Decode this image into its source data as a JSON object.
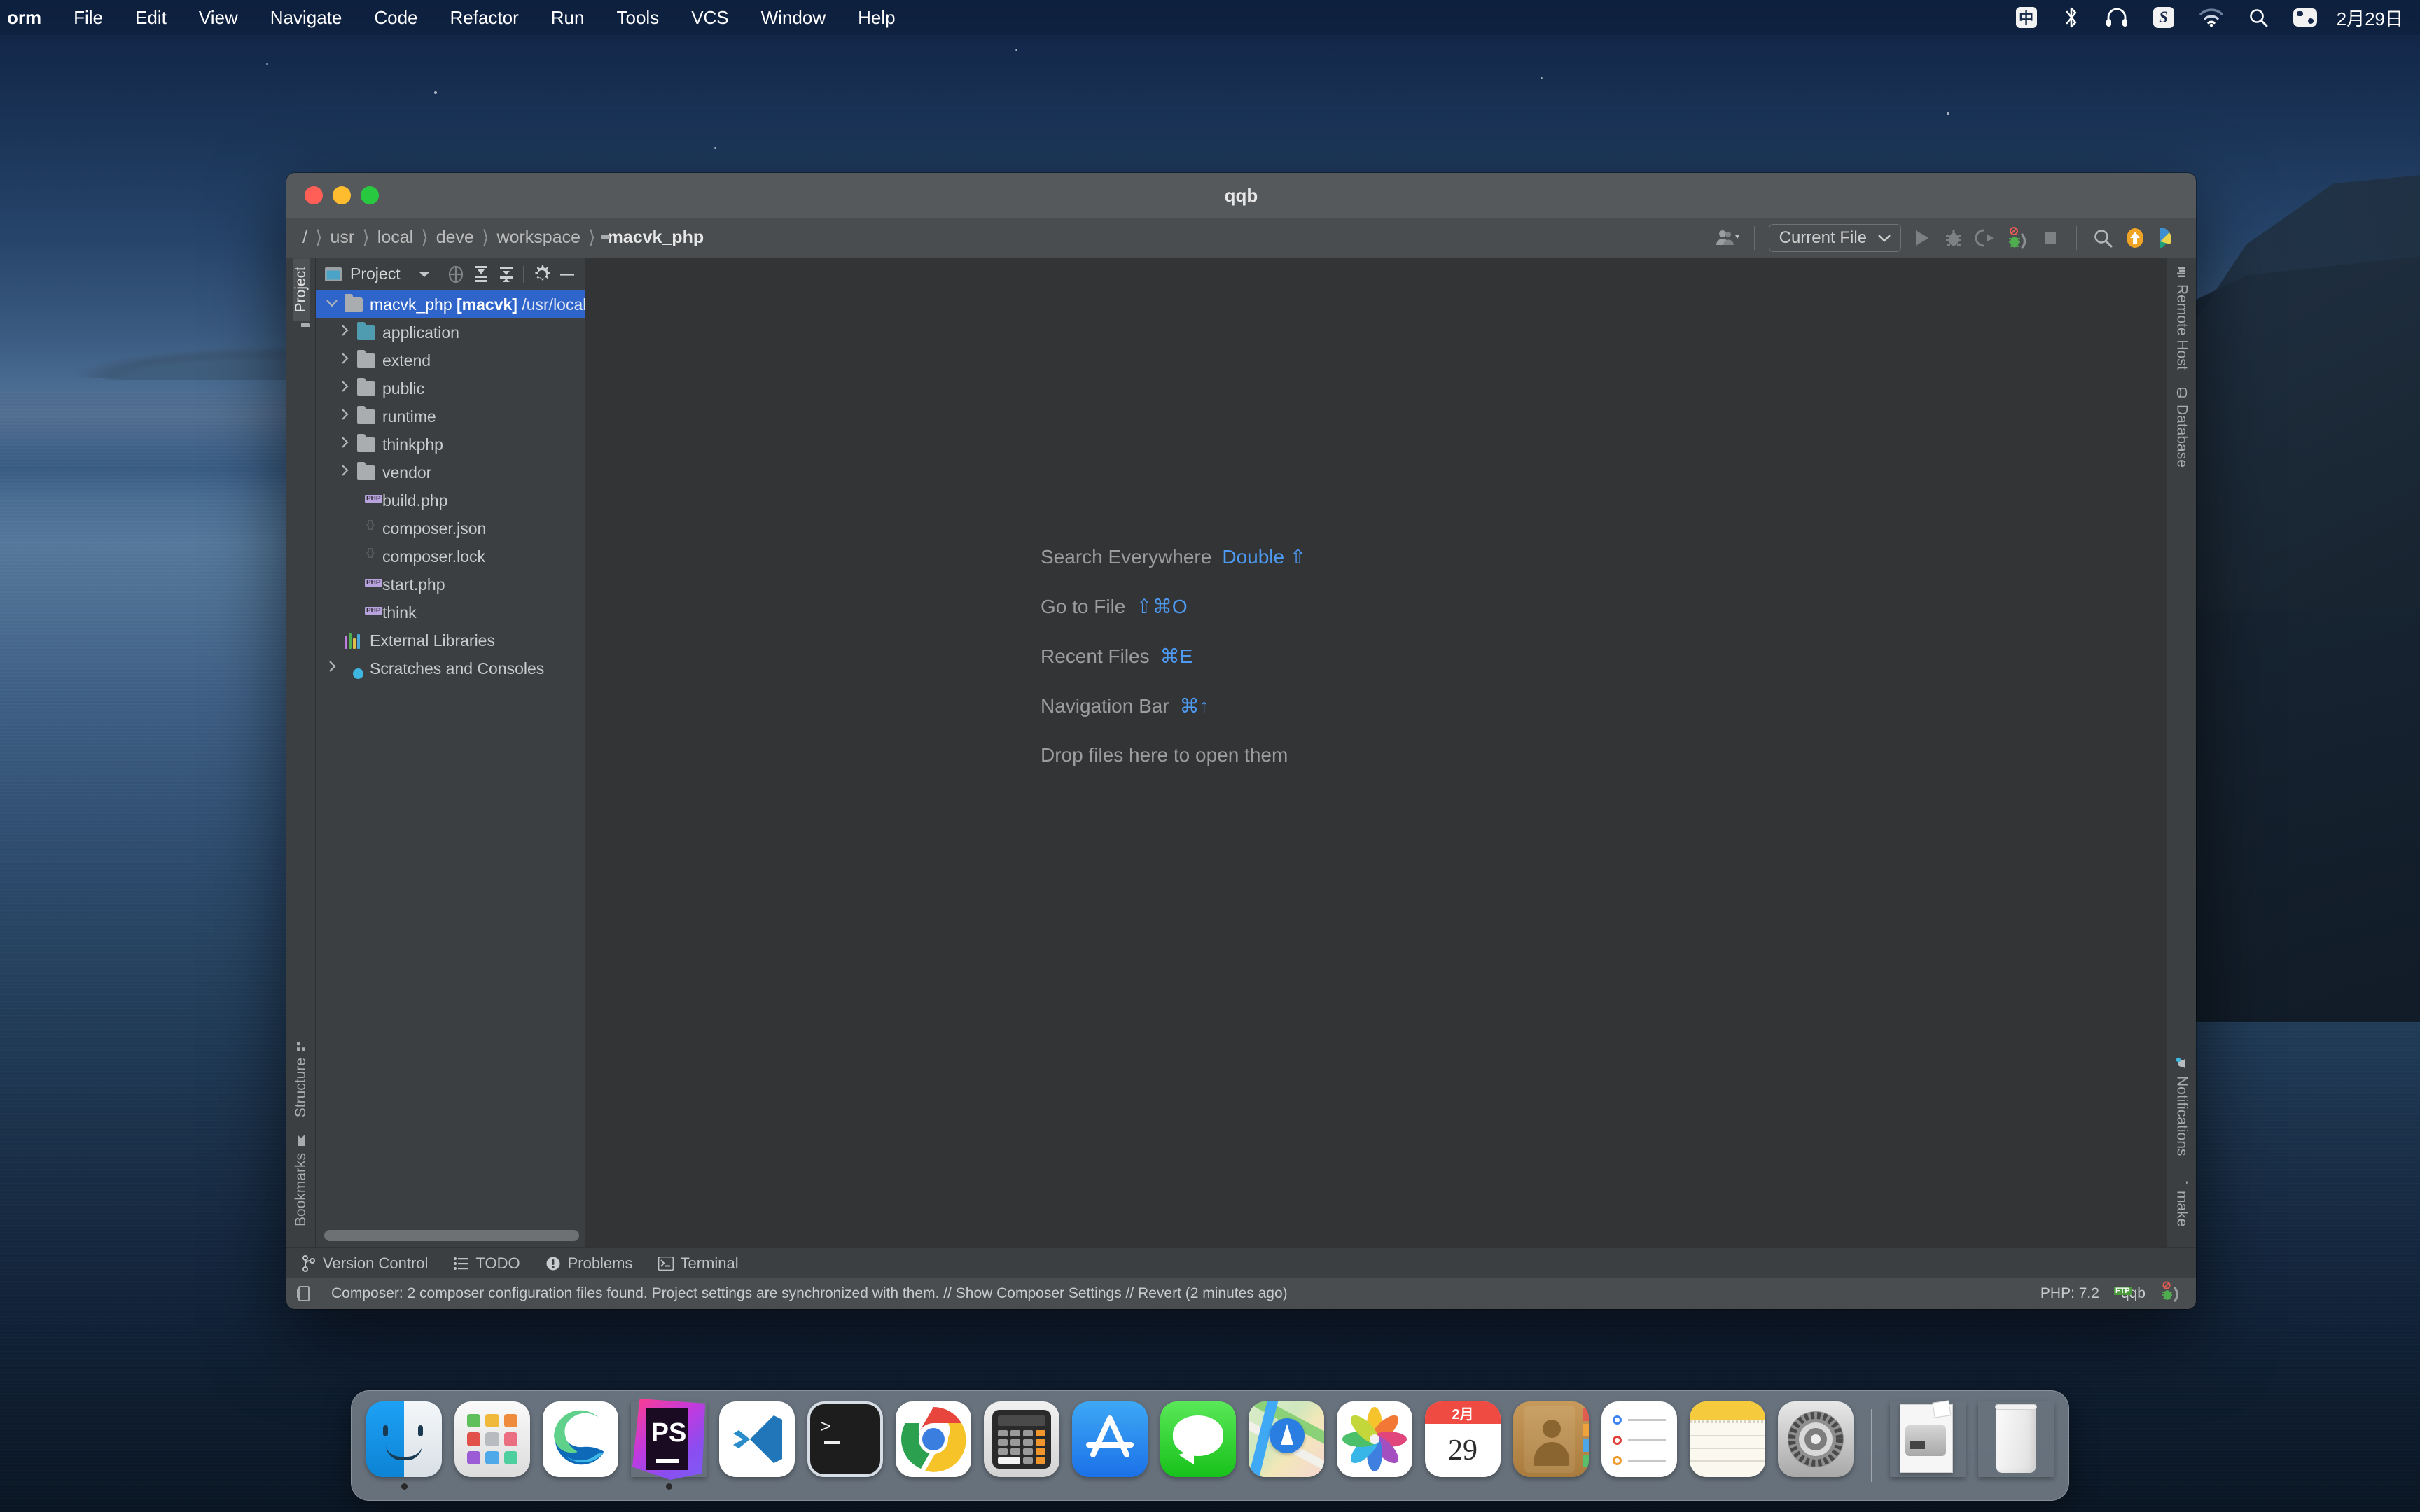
{
  "menubar": {
    "items": [
      "orm",
      "File",
      "Edit",
      "View",
      "Navigate",
      "Code",
      "Refactor",
      "Run",
      "Tools",
      "VCS",
      "Window",
      "Help"
    ],
    "status_icons": [
      "ime-chinese-icon",
      "bluetooth-icon",
      "headphones-icon",
      "sogou-input-icon",
      "wifi-icon",
      "spotlight-search-icon",
      "control-center-icon"
    ],
    "ime_label": "中",
    "sogou_label": "S",
    "clock": "2月29日"
  },
  "ide": {
    "window_title": "qqb",
    "breadcrumb": [
      "/",
      "usr",
      "local",
      "deve",
      "workspace"
    ],
    "breadcrumb_current": "macvk_php",
    "toolbar": {
      "run_config": "Current File",
      "icons": [
        "user-avatar-dropdown-icon",
        "run-icon",
        "debug-icon",
        "run-with-coverage-icon",
        "profile-debug-icon",
        "stop-icon",
        "search-everywhere-icon",
        "update-project-icon",
        "deploy-icon"
      ]
    },
    "left_strip": {
      "top": [
        {
          "label": "Project",
          "active": true,
          "icon": "project-icon"
        }
      ],
      "bottom": [
        {
          "label": "Structure",
          "active": false,
          "icon": "structure-icon"
        },
        {
          "label": "Bookmarks",
          "active": false,
          "icon": "bookmarks-icon"
        }
      ]
    },
    "right_strip": {
      "top": [
        {
          "label": "Remote Host",
          "icon": "remote-host-icon"
        },
        {
          "label": "Database",
          "icon": "database-icon"
        }
      ],
      "bottom": [
        {
          "label": "Notifications",
          "icon": "notifications-icon"
        },
        {
          "label": "make",
          "icon": "make-icon"
        }
      ]
    },
    "project_panel": {
      "title": "Project",
      "header_icons": [
        "select-opened-file-icon",
        "expand-all-icon",
        "collapse-all-icon",
        "settings-gear-icon",
        "hide-icon"
      ],
      "tree": [
        {
          "indent": 0,
          "twisty": "down",
          "icon": "folder-module-icon",
          "label": "macvk_php",
          "bracket": "[macvk]",
          "path": "/usr/local/deve/workspace/ma",
          "selected": true
        },
        {
          "indent": 1,
          "twisty": "right",
          "icon": "folder-source-icon",
          "label": "application",
          "selected": false
        },
        {
          "indent": 1,
          "twisty": "right",
          "icon": "folder-icon",
          "label": "extend",
          "selected": false
        },
        {
          "indent": 1,
          "twisty": "right",
          "icon": "folder-icon",
          "label": "public",
          "selected": false
        },
        {
          "indent": 1,
          "twisty": "right",
          "icon": "folder-icon",
          "label": "runtime",
          "selected": false
        },
        {
          "indent": 1,
          "twisty": "right",
          "icon": "folder-icon",
          "label": "thinkphp",
          "selected": false
        },
        {
          "indent": 1,
          "twisty": "right",
          "icon": "folder-icon",
          "label": "vendor",
          "selected": false
        },
        {
          "indent": 1,
          "twisty": "none",
          "icon": "php-file-icon",
          "label": "build.php",
          "selected": false
        },
        {
          "indent": 1,
          "twisty": "none",
          "icon": "json-file-icon",
          "label": "composer.json",
          "selected": false
        },
        {
          "indent": 1,
          "twisty": "none",
          "icon": "json-file-icon",
          "label": "composer.lock",
          "selected": false
        },
        {
          "indent": 1,
          "twisty": "none",
          "icon": "php-file-icon",
          "label": "start.php",
          "selected": false
        },
        {
          "indent": 1,
          "twisty": "none",
          "icon": "php-file-icon",
          "label": "think",
          "selected": false
        },
        {
          "indent": 0,
          "twisty": "none",
          "icon": "external-libraries-icon",
          "label": "External Libraries",
          "selected": false
        },
        {
          "indent": 0,
          "twisty": "right",
          "icon": "scratches-icon",
          "label": "Scratches and Consoles",
          "selected": false
        }
      ]
    },
    "editor_hints": [
      {
        "label": "Search Everywhere",
        "shortcut": "Double ⇧"
      },
      {
        "label": "Go to File",
        "shortcut": "⇧⌘O"
      },
      {
        "label": "Recent Files",
        "shortcut": "⌘E"
      },
      {
        "label": "Navigation Bar",
        "shortcut": "⌘↑"
      },
      {
        "label": "Drop files here to open them",
        "shortcut": ""
      }
    ],
    "bottom_tabs": [
      {
        "label": "Version Control",
        "icon": "branch-icon"
      },
      {
        "label": "TODO",
        "icon": "todo-list-icon"
      },
      {
        "label": "Problems",
        "icon": "problems-icon"
      },
      {
        "label": "Terminal",
        "icon": "terminal-icon"
      }
    ],
    "status_bar": {
      "message": "Composer: 2 composer configuration files found. Project settings are synchronized with them. // Show Composer Settings // Revert (2 minutes ago)",
      "php_version": "PHP: 7.2",
      "deployment_server": "qqb",
      "deployment_badge": "FTP",
      "icons": [
        "memory-indicator-icon",
        "ftp-server-icon",
        "php-debug-listener-icon"
      ]
    }
  },
  "dock": {
    "apps": [
      {
        "name": "Finder",
        "icon": "finder-icon",
        "running": true
      },
      {
        "name": "Launchpad",
        "icon": "launchpad-icon",
        "running": false
      },
      {
        "name": "Microsoft Edge",
        "icon": "edge-icon",
        "running": false
      },
      {
        "name": "PhpStorm",
        "icon": "phpstorm-icon",
        "running": true,
        "badge": "PS"
      },
      {
        "name": "Visual Studio Code",
        "icon": "vscode-icon",
        "running": false
      },
      {
        "name": "Terminal",
        "icon": "terminal-app-icon",
        "running": false
      },
      {
        "name": "Google Chrome",
        "icon": "chrome-icon",
        "running": false
      },
      {
        "name": "Calculator",
        "icon": "calculator-icon",
        "running": false
      },
      {
        "name": "App Store",
        "icon": "app-store-icon",
        "running": false
      },
      {
        "name": "Messages",
        "icon": "messages-icon",
        "running": false
      },
      {
        "name": "Maps",
        "icon": "maps-icon",
        "running": false
      },
      {
        "name": "Photos",
        "icon": "photos-icon",
        "running": false
      },
      {
        "name": "Calendar",
        "icon": "calendar-icon",
        "running": false,
        "month": "2月",
        "day": "29"
      },
      {
        "name": "Contacts",
        "icon": "contacts-icon",
        "running": false
      },
      {
        "name": "Reminders",
        "icon": "reminders-icon",
        "running": false
      },
      {
        "name": "Notes",
        "icon": "notes-icon",
        "running": false
      },
      {
        "name": "System Preferences",
        "icon": "system-preferences-icon",
        "running": false
      }
    ],
    "extras": [
      {
        "name": "Downloads",
        "icon": "downloads-stack-icon"
      },
      {
        "name": "Trash",
        "icon": "trash-icon"
      }
    ]
  },
  "colors": {
    "accent_blue": "#2f65ca",
    "hint_blue": "#4d9bf5",
    "ide_bg": "#3c3f41",
    "editor_bg": "#333436",
    "source_folder": "#4f9bb0"
  }
}
